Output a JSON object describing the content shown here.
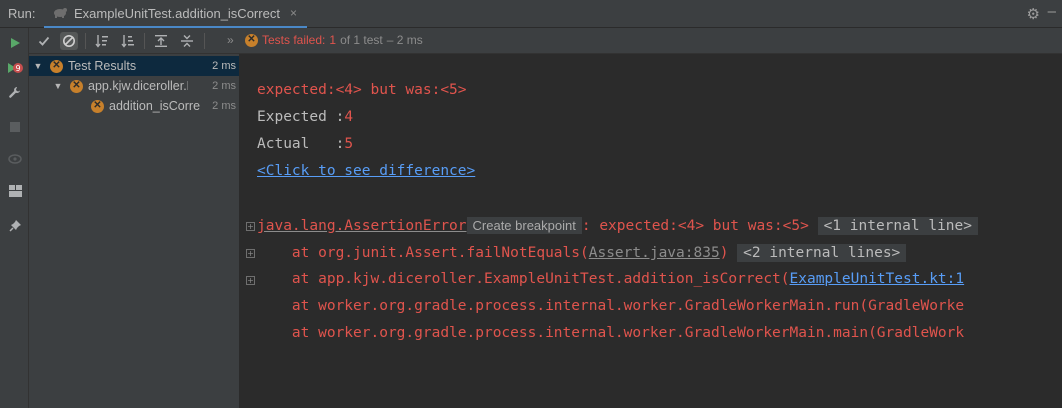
{
  "run_bar": {
    "label": "Run:",
    "tab_title": "ExampleUnitTest.addition_isCorrect",
    "tab_close": "×"
  },
  "toolbar": {
    "status_prefix": "Tests failed:",
    "failed_count": "1",
    "of_total": "of 1 test",
    "duration": "– 2 ms"
  },
  "tree": {
    "root": {
      "label": "Test Results",
      "time": "2 ms"
    },
    "class_node": {
      "label": "app.kjw.diceroller.Ex",
      "time": "2 ms"
    },
    "method_node": {
      "label": "addition_isCorre",
      "time": "2 ms"
    }
  },
  "console": {
    "expected_line": "expected:<4> but was:<5>",
    "expected_label": "Expected :",
    "expected_value": "4",
    "actual_label": "Actual   :",
    "actual_value": "5",
    "diff_link": "<Click to see difference>",
    "exception_class": "java.lang.AssertionError",
    "create_breakpoint": "Create breakpoint",
    "exception_msg": ": expected:<4> but was:<5>",
    "internal_lines_1": "<1 internal line>",
    "trace1_prefix": "    at org.junit.Assert.failNotEquals(",
    "trace1_link": "Assert.java:835",
    "trace1_suffix": ")",
    "internal_lines_2": "<2 internal lines>",
    "trace2_prefix": "    at app.kjw.diceroller.ExampleUnitTest.addition_isCorrect(",
    "trace2_link": "ExampleUnitTest.kt:1",
    "trace3": "    at worker.org.gradle.process.internal.worker.GradleWorkerMain.run(GradleWorke",
    "trace4": "    at worker.org.gradle.process.internal.worker.GradleWorkerMain.main(GradleWork"
  },
  "colors": {
    "error_red": "#e0544d",
    "link_blue": "#589df6",
    "warning_orange": "#c7802b",
    "run_green": "#59a869"
  }
}
